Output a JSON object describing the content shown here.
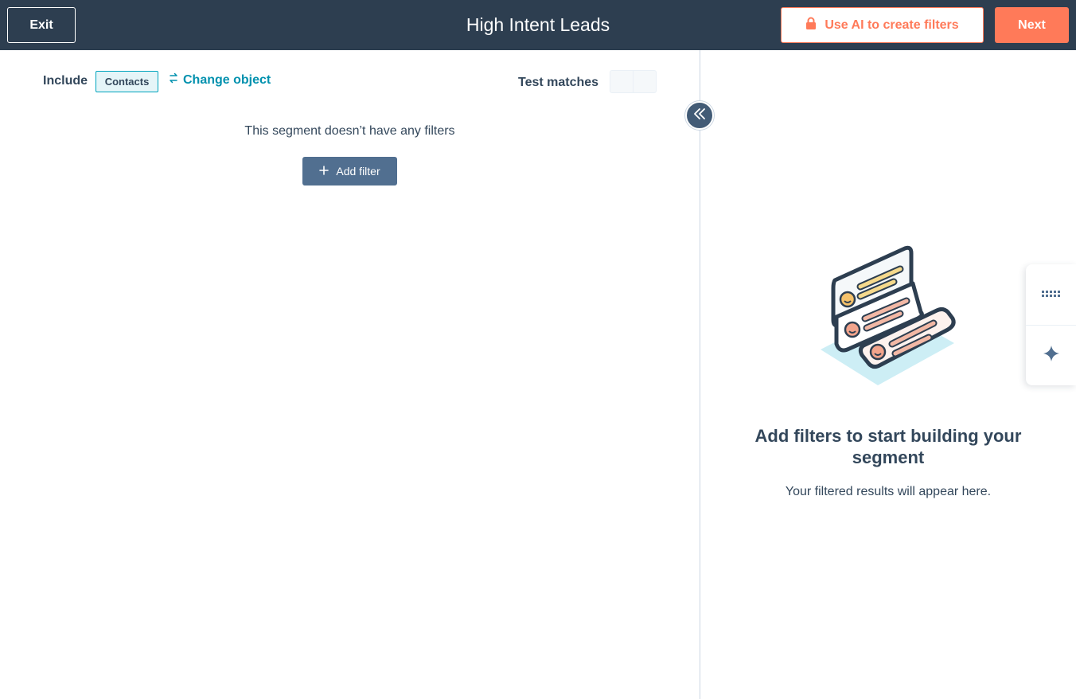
{
  "header": {
    "exit_label": "Exit",
    "title": "High Intent Leads",
    "ai_button_label": "Use AI to create filters",
    "next_label": "Next"
  },
  "filters": {
    "include_label": "Include",
    "object_tag": "Contacts",
    "change_object_label": "Change object",
    "test_matches_label": "Test matches",
    "empty_text": "This segment doesn’t have any filters",
    "add_filter_label": "Add filter"
  },
  "results": {
    "heading": "Add filters to start building your segment",
    "subtext": "Your filtered results will appear here."
  },
  "icons": {
    "ai_button": "lock-icon",
    "change_object": "swap-arrows-icon",
    "add_filter": "plus-icon",
    "collapse": "double-chevron-left-icon",
    "rail_top": "keyboard-icon",
    "rail_bottom": "sparkle-icon"
  },
  "colors": {
    "header_bg": "#2d3e50",
    "accent": "#ff7a59",
    "link": "#0091ae",
    "primary_button": "#516f90",
    "text": "#33475b"
  }
}
